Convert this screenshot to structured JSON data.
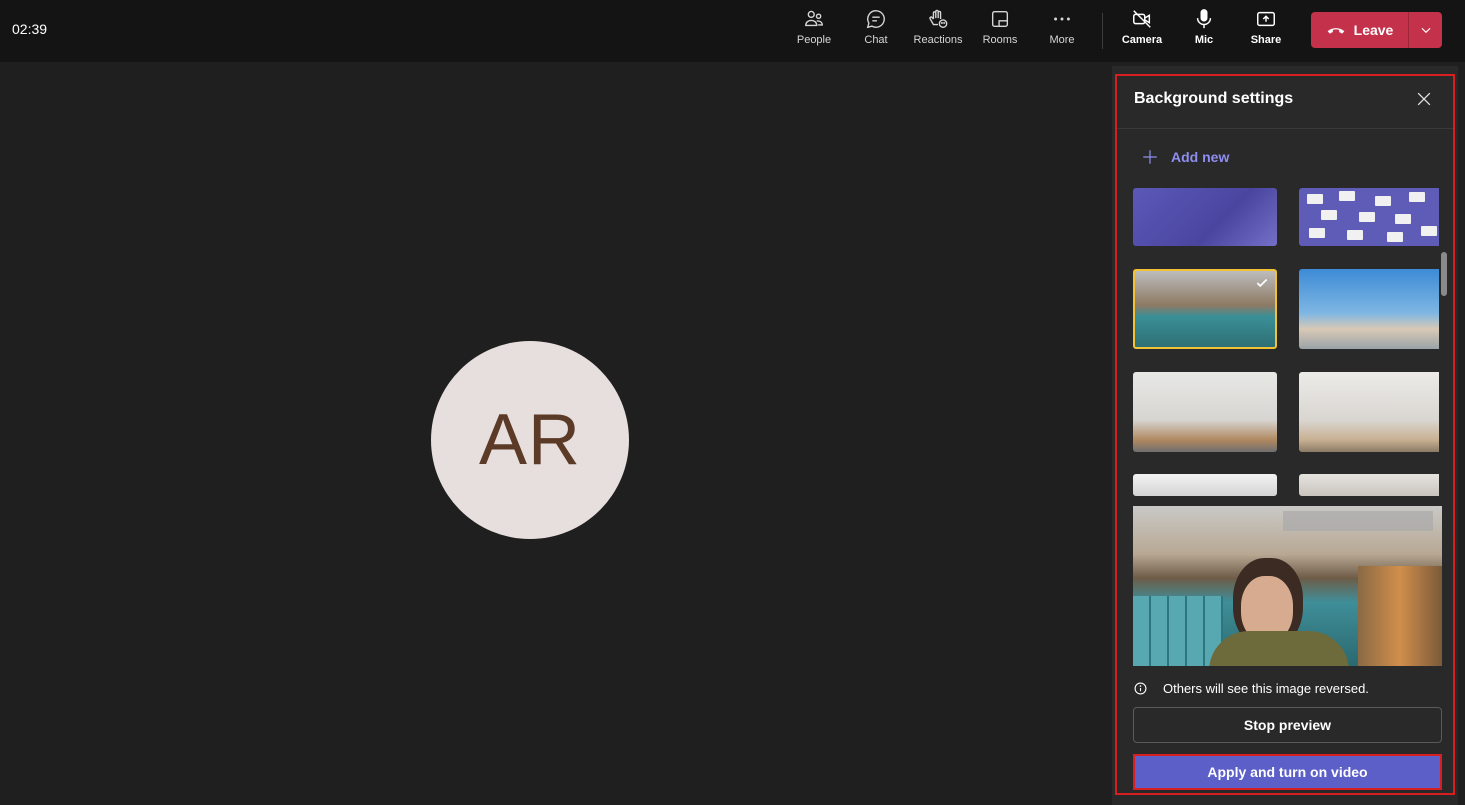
{
  "topbar": {
    "timer": "02:39",
    "buttons": [
      {
        "label": "People",
        "icon": "people-icon"
      },
      {
        "label": "Chat",
        "icon": "chat-icon"
      },
      {
        "label": "Reactions",
        "icon": "reactions-icon"
      },
      {
        "label": "Rooms",
        "icon": "rooms-icon"
      },
      {
        "label": "More",
        "icon": "more-icon"
      },
      {
        "label": "Camera",
        "icon": "camera-off-icon"
      },
      {
        "label": "Mic",
        "icon": "mic-icon"
      },
      {
        "label": "Share",
        "icon": "share-icon"
      }
    ],
    "leave_label": "Leave",
    "leave_color": "#c4314b"
  },
  "stage": {
    "avatar_initials": "AR"
  },
  "panel": {
    "title": "Background settings",
    "add_new_label": "Add new",
    "selected_thumbnail": 3,
    "info_text": "Others will see this image reversed.",
    "stop_preview_label": "Stop preview",
    "apply_label": "Apply and turn on video",
    "accent_color": "#5b5fc7",
    "selected_border_color": "#f2c234"
  }
}
